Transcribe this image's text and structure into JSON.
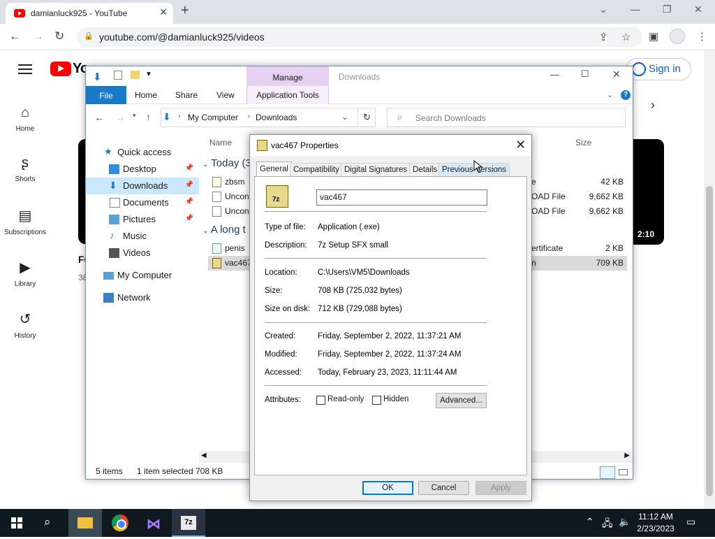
{
  "chrome": {
    "tab_title": "damianluck925 - YouTube",
    "url": "youtube.com/@damianluck925/videos"
  },
  "youtube": {
    "logo_text": "YouTube",
    "nav": [
      {
        "label": "Home",
        "icon": "home-icon"
      },
      {
        "label": "Shorts",
        "icon": "shorts-icon"
      },
      {
        "label": "Subscriptions",
        "icon": "subscriptions-icon"
      },
      {
        "label": "Library",
        "icon": "library-icon"
      },
      {
        "label": "History",
        "icon": "history-icon"
      }
    ],
    "signin_label": "Sign in",
    "video_duration": "2:10",
    "video_title_fragment": "Fu",
    "video_meta_fragment": "38"
  },
  "explorer": {
    "window_title": "Downloads",
    "manage_label": "Manage",
    "ribbon_tabs": [
      "File",
      "Home",
      "Share",
      "View"
    ],
    "app_tools_label": "Application Tools",
    "breadcrumb": [
      "My Computer",
      "Downloads"
    ],
    "search_placeholder": "Search Downloads",
    "nav": {
      "quick_access": "Quick access",
      "items": [
        "Desktop",
        "Downloads",
        "Documents",
        "Pictures",
        "Music",
        "Videos"
      ],
      "my_computer": "My Computer",
      "network": "Network"
    },
    "columns": {
      "name": "Name",
      "size": "Size"
    },
    "groups": {
      "today": "Today (3",
      "long_ago": "A long t"
    },
    "files": [
      {
        "name": "zbsm",
        "type": "e",
        "size": "42 KB"
      },
      {
        "name": "Uncont",
        "type": "OAD File",
        "size": "9,662 KB"
      },
      {
        "name": "Uncont",
        "type": "OAD File",
        "size": "9,662 KB"
      },
      {
        "name": "penis",
        "type": "ertificate",
        "size": "2 KB"
      },
      {
        "name": "vac467",
        "type": "n",
        "size": "709 KB"
      }
    ],
    "status": {
      "items": "5 items",
      "selected": "1 item selected  708 KB"
    }
  },
  "properties": {
    "title": "vac467 Properties",
    "tabs": [
      "General",
      "Compatibility",
      "Digital Signatures",
      "Details",
      "Previous Versions"
    ],
    "file_name": "vac467",
    "type_label": "Type of file:",
    "type_value": "Application (.exe)",
    "desc_label": "Description:",
    "desc_value": "7z Setup SFX small",
    "location_label": "Location:",
    "location_value": "C:\\Users\\VM5\\Downloads",
    "size_label": "Size:",
    "size_value": "708 KB (725,032 bytes)",
    "disk_label": "Size on disk:",
    "disk_value": "712 KB (729,088 bytes)",
    "created_label": "Created:",
    "created_value": "Friday, September 2, 2022, 11:37:21 AM",
    "modified_label": "Modified:",
    "modified_value": "Friday, September 2, 2022, 11:37:24 AM",
    "accessed_label": "Accessed:",
    "accessed_value": "Today, February 23, 2023, 11:11:44 AM",
    "attributes_label": "Attributes:",
    "readonly_label": "Read-only",
    "hidden_label": "Hidden",
    "advanced_label": "Advanced...",
    "ok_label": "OK",
    "cancel_label": "Cancel",
    "apply_label": "Apply"
  },
  "taskbar": {
    "time": "11:12 AM",
    "date": "2/23/2023",
    "sevenzip_label": "7z"
  }
}
